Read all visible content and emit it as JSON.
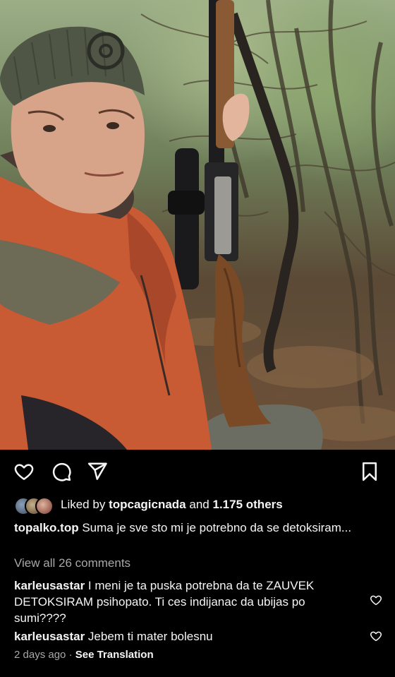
{
  "post": {
    "likes": {
      "prefix": "Liked by",
      "user": "topcagicnada",
      "connector": "and",
      "others": "1.175 others"
    },
    "caption": {
      "username": "topalko.top",
      "text": "Suma je sve sto mi je potrebno da se detoksiram..."
    },
    "view_all_comments": "View all 26 comments",
    "comments": [
      {
        "username": "karleusastar",
        "text": "I meni je ta puska potrebna da te ZAUVEK DETOKSIRAM psihopato. Ti ces indijanac da ubijas po sumi????"
      },
      {
        "username": "karleusastar",
        "text": "Jebem ti mater bolesnu"
      }
    ],
    "timestamp": "2 days ago",
    "separator": "·",
    "see_translation": "See Translation"
  },
  "actions": {
    "like_icon": "heart-icon",
    "comment_icon": "comment-icon",
    "share_icon": "send-icon",
    "save_icon": "bookmark-icon"
  },
  "colors": {
    "background": "#000000",
    "text": "#f5f5f5",
    "muted": "#a8a8a8"
  }
}
